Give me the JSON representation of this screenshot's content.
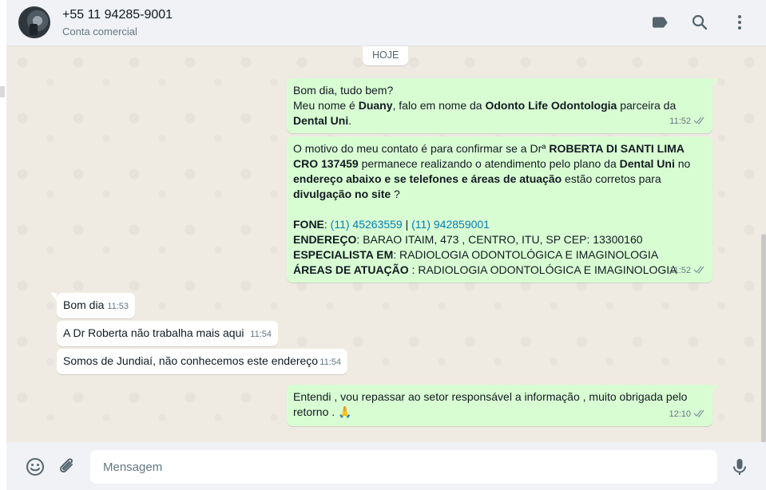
{
  "header": {
    "contact_name": "+55 11 94285-9001",
    "contact_subtitle": "Conta comercial",
    "icons": [
      "label-icon",
      "search-icon",
      "menu-icon"
    ]
  },
  "chat": {
    "date_chip": "HOJE",
    "messages": [
      {
        "direction": "out",
        "lines": [
          [
            {
              "t": "Bom dia, tudo bem?"
            }
          ],
          [
            {
              "t": "Meu nome é "
            },
            {
              "t": "Duany",
              "b": true
            },
            {
              "t": ", falo em nome da "
            },
            {
              "t": "Odonto Life Odontologia",
              "b": true
            },
            {
              "t": " parceira da"
            }
          ],
          [
            {
              "t": "Dental Uni",
              "b": true
            },
            {
              "t": "."
            }
          ]
        ],
        "time": "11:52",
        "status": "read"
      },
      {
        "direction": "out",
        "lines": [
          [
            {
              "t": "O motivo do meu contato é para confirmar se a Drª "
            },
            {
              "t": "ROBERTA DI SANTI LIMA",
              "b": true
            }
          ],
          [
            {
              "t": "CRO 137459",
              "b": true
            },
            {
              "t": " permanece realizando o atendimento pelo plano da "
            },
            {
              "t": "Dental Uni",
              "b": true
            },
            {
              "t": " no"
            }
          ],
          [
            {
              "t": "endereço abaixo e se telefones e áreas de atuação",
              "b": true
            },
            {
              "t": " estão corretos para"
            }
          ],
          [
            {
              "t": "divulgação no site",
              "b": true
            },
            {
              "t": " ?"
            }
          ],
          [],
          [
            {
              "t": "FONE",
              "b": true
            },
            {
              "t": ": "
            },
            {
              "t": "(11) 45263559",
              "link": true
            },
            {
              "t": " | "
            },
            {
              "t": "(11) 942859001",
              "link": true
            }
          ],
          [
            {
              "t": "ENDEREÇO",
              "b": true
            },
            {
              "t": ": BARAO ITAIM, 473 , CENTRO, ITU, SP CEP: 13300160"
            }
          ],
          [
            {
              "t": "ESPECIALISTA EM",
              "b": true
            },
            {
              "t": ": RADIOLOGIA ODONTOLÓGICA E IMAGINOLOGIA"
            }
          ],
          [
            {
              "t": "ÁREAS DE ATUAÇÃO",
              "b": true
            },
            {
              "t": " : RADIOLOGIA ODONTOLÓGICA E IMAGINOLOGIA"
            }
          ]
        ],
        "time": "11:52",
        "status": "read"
      },
      {
        "direction": "in",
        "lines": [
          [
            {
              "t": "Bom dia"
            }
          ]
        ],
        "time": "11:53"
      },
      {
        "direction": "in",
        "lines": [
          [
            {
              "t": "A Dr Roberta não trabalha mais aqui"
            }
          ]
        ],
        "time": "11:54"
      },
      {
        "direction": "in",
        "lines": [
          [
            {
              "t": "Somos de Jundiaí, não conhecemos este endereço"
            }
          ]
        ],
        "time": "11:54"
      },
      {
        "direction": "out",
        "lines": [
          [
            {
              "t": "Entendi , vou repassar ao setor responsável a informação , muito obrigada pelo"
            }
          ],
          [
            {
              "t": "retorno . 🙏"
            }
          ]
        ],
        "time": "12:10",
        "status": "read"
      }
    ]
  },
  "footer": {
    "placeholder": "Mensagem",
    "value": "",
    "icons": [
      "emoji-icon",
      "attach-icon",
      "mic-icon"
    ]
  },
  "colors": {
    "outgoing_bubble": "#d9fdd3",
    "incoming_bubble": "#ffffff",
    "chat_background": "#efeae2",
    "link": "#027eb5",
    "header_background": "#f0f2f5"
  }
}
